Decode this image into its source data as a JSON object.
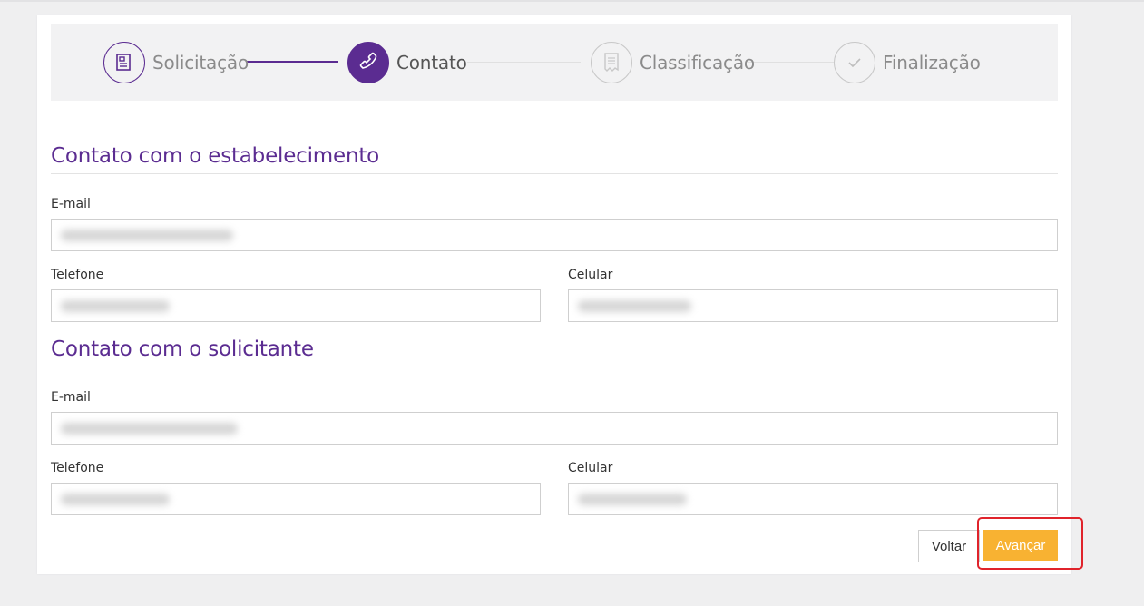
{
  "stepper": {
    "steps": [
      {
        "label": "Solicitação",
        "icon": "document-icon",
        "state": "done"
      },
      {
        "label": "Contato",
        "icon": "phone-icon",
        "state": "active"
      },
      {
        "label": "Classificação",
        "icon": "receipt-icon",
        "state": "inactive"
      },
      {
        "label": "Finalização",
        "icon": "check-icon",
        "state": "inactive"
      }
    ]
  },
  "establishment": {
    "title": "Contato com o estabelecimento",
    "email_label": "E-mail",
    "phone_label": "Telefone",
    "mobile_label": "Celular"
  },
  "requester": {
    "title": "Contato com o solicitante",
    "email_label": "E-mail",
    "phone_label": "Telefone",
    "mobile_label": "Celular"
  },
  "actions": {
    "back_label": "Voltar",
    "next_label": "Avançar"
  },
  "colors": {
    "brand_purple": "#5b2c91",
    "accent_yellow": "#f8b232",
    "highlight_red": "#e0232b"
  }
}
